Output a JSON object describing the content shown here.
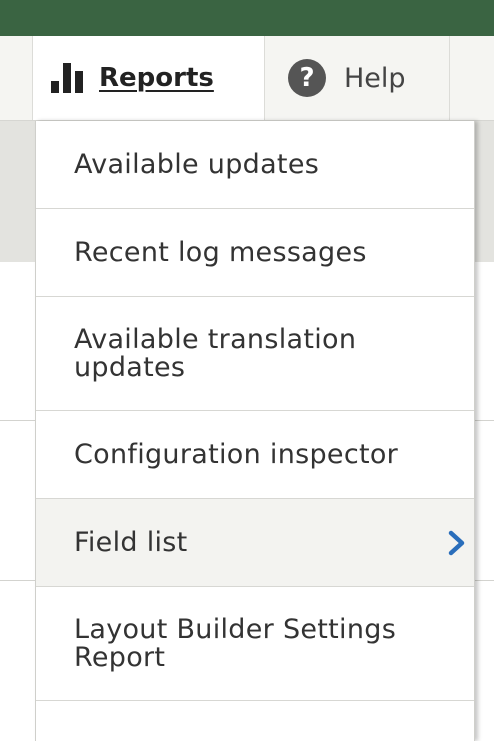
{
  "toolbar": {
    "reports_label": "Reports",
    "help_label": "Help",
    "help_icon_glyph": "?"
  },
  "menu": {
    "items": [
      {
        "label": "Available updates"
      },
      {
        "label": "Recent log messages"
      },
      {
        "label": "Available translation updates"
      },
      {
        "label": "Configuration inspector"
      },
      {
        "label": "Field list",
        "has_submenu": true
      },
      {
        "label": "Layout Builder Settings Report"
      }
    ]
  },
  "colors": {
    "top_bar": "#3a6442",
    "toolbar_bg": "#f5f5f2",
    "chevron": "#2a6ebb",
    "menu_hover": "#f3f3f0"
  },
  "icons": {
    "reports": "bar-chart-icon",
    "help": "question-circle-icon",
    "submenu": "chevron-right-icon"
  }
}
